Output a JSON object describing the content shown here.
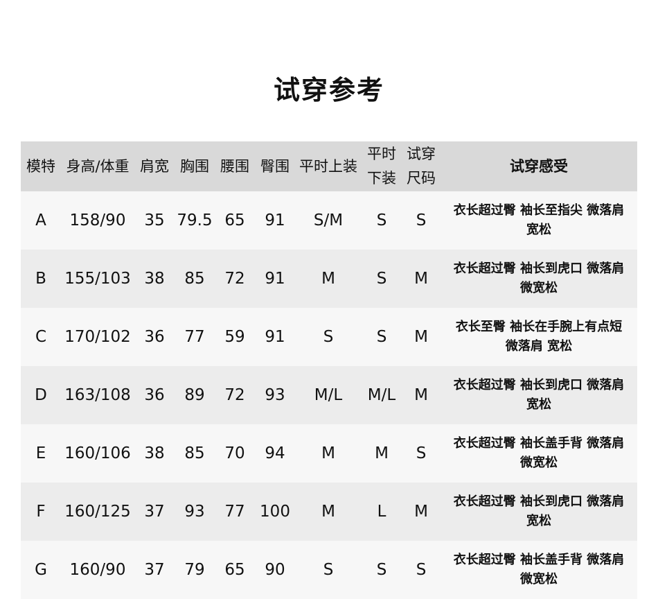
{
  "title": "试穿参考",
  "headers": {
    "model": "模特",
    "height_weight": "身高/体重",
    "shoulder": "肩宽",
    "chest": "胸围",
    "waist": "腰围",
    "hip": "臀围",
    "usual_top": "平时上装",
    "usual_bottom_l1": "平时",
    "usual_bottom_l2": "下装",
    "try_size_l1": "试穿",
    "try_size_l2": "尺码",
    "feel": "试穿感受"
  },
  "rows": [
    {
      "model": "A",
      "height_weight": "158/90",
      "shoulder": "35",
      "chest": "79.5",
      "waist": "65",
      "hip": "91",
      "top": "S/M",
      "bottom": "S",
      "size": "S",
      "feel_l1": "衣长超过臀 袖长至指尖 微落肩",
      "feel_l2": "宽松"
    },
    {
      "model": "B",
      "height_weight": "155/103",
      "shoulder": "38",
      "chest": "85",
      "waist": "72",
      "hip": "91",
      "top": "M",
      "bottom": "S",
      "size": "M",
      "feel_l1": "衣长超过臀 袖长到虎口 微落肩",
      "feel_l2": "微宽松"
    },
    {
      "model": "C",
      "height_weight": "170/102",
      "shoulder": "36",
      "chest": "77",
      "waist": "59",
      "hip": "91",
      "top": "S",
      "bottom": "S",
      "size": "M",
      "feel_l1": "衣长至臀 袖长在手腕上有点短",
      "feel_l2": "微落肩 宽松"
    },
    {
      "model": "D",
      "height_weight": "163/108",
      "shoulder": "36",
      "chest": "89",
      "waist": "72",
      "hip": "93",
      "top": "M/L",
      "bottom": "M/L",
      "size": "M",
      "feel_l1": "衣长超过臀 袖长到虎口 微落肩",
      "feel_l2": "宽松"
    },
    {
      "model": "E",
      "height_weight": "160/106",
      "shoulder": "38",
      "chest": "85",
      "waist": "70",
      "hip": "94",
      "top": "M",
      "bottom": "M",
      "size": "S",
      "feel_l1": "衣长超过臀 袖长盖手背 微落肩",
      "feel_l2": "微宽松"
    },
    {
      "model": "F",
      "height_weight": "160/125",
      "shoulder": "37",
      "chest": "93",
      "waist": "77",
      "hip": "100",
      "top": "M",
      "bottom": "L",
      "size": "M",
      "feel_l1": "衣长超过臀 袖长到虎口 微落肩",
      "feel_l2": "宽松"
    },
    {
      "model": "G",
      "height_weight": "160/90",
      "shoulder": "37",
      "chest": "79",
      "waist": "65",
      "hip": "90",
      "top": "S",
      "bottom": "S",
      "size": "S",
      "feel_l1": "衣长超过臀 袖长盖手背 微落肩",
      "feel_l2": "微宽松"
    }
  ]
}
